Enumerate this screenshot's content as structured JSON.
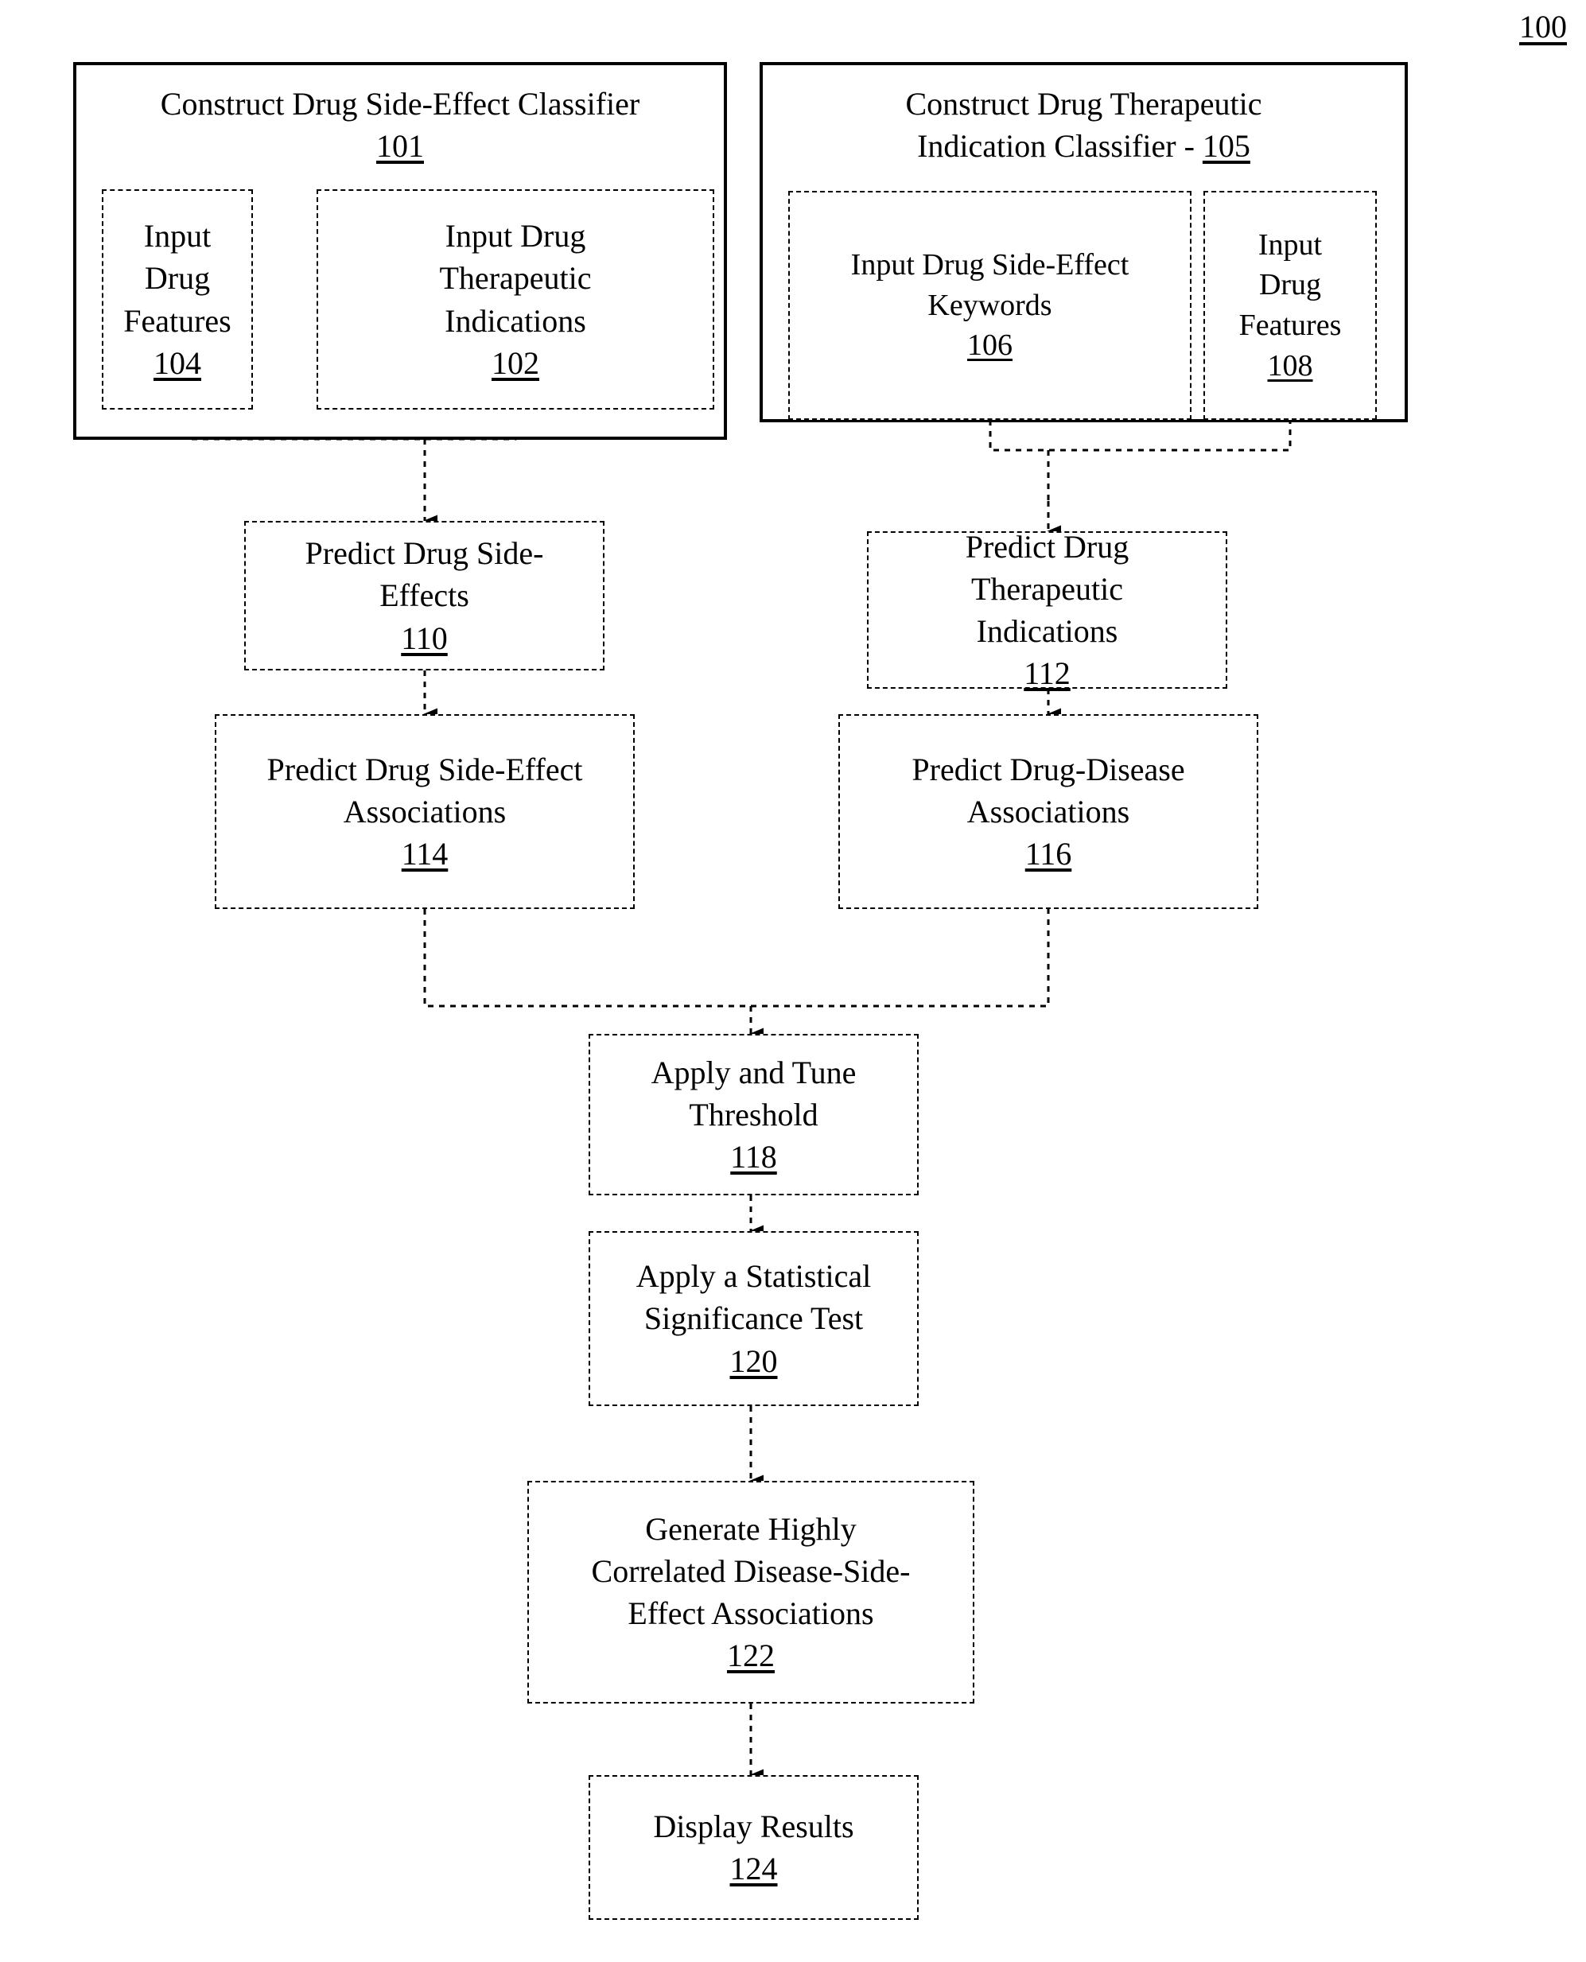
{
  "figure": {
    "label": "100"
  },
  "classifiers": [
    {
      "id": "side-effect-classifier",
      "title_lines": [
        "Construct Drug Side-Effect Classifier"
      ],
      "number": "101",
      "number_inline": false,
      "inputs": [
        {
          "id": "input-drug-features-104",
          "lines": [
            "Input",
            "Drug",
            "Features"
          ],
          "number": "104"
        },
        {
          "id": "input-drug-therapeutic-indications-102",
          "lines": [
            "Input Drug",
            "Therapeutic",
            "Indications"
          ],
          "number": "102"
        }
      ]
    },
    {
      "id": "therapeutic-indication-classifier",
      "title_lines": [
        "Construct Drug Therapeutic",
        "Indication Classifier - "
      ],
      "number": "105",
      "number_inline": true,
      "inputs": [
        {
          "id": "input-drug-side-effect-keywords-106",
          "lines": [
            "Input Drug Side-Effect",
            "Keywords"
          ],
          "number": "106"
        },
        {
          "id": "input-drug-features-108",
          "lines": [
            "Input",
            "Drug",
            "Features"
          ],
          "number": "108"
        }
      ]
    }
  ],
  "steps": {
    "predict_side_effects": {
      "lines": [
        "Predict Drug Side-",
        "Effects"
      ],
      "number": "110"
    },
    "predict_therapeutic_indications": {
      "lines": [
        "Predict Drug",
        "Therapeutic",
        "Indications"
      ],
      "number": "112"
    },
    "predict_side_effect_associations": {
      "lines": [
        "Predict Drug Side-Effect",
        "Associations"
      ],
      "number": "114"
    },
    "predict_drug_disease_associations": {
      "lines": [
        "Predict Drug-Disease",
        "Associations"
      ],
      "number": "116"
    },
    "apply_tune_threshold": {
      "lines": [
        "Apply and Tune",
        "Threshold"
      ],
      "number": "118"
    },
    "apply_statistical_significance_test": {
      "lines": [
        "Apply a Statistical",
        "Significance Test"
      ],
      "number": "120"
    },
    "generate_correlated_associations": {
      "lines": [
        "Generate Highly",
        "Correlated Disease-Side-",
        "Effect Associations"
      ],
      "number": "122"
    },
    "display_results": {
      "lines": [
        "Display Results"
      ],
      "number": "124"
    }
  },
  "colors": {
    "ink": "#000000",
    "paper": "#ffffff"
  }
}
